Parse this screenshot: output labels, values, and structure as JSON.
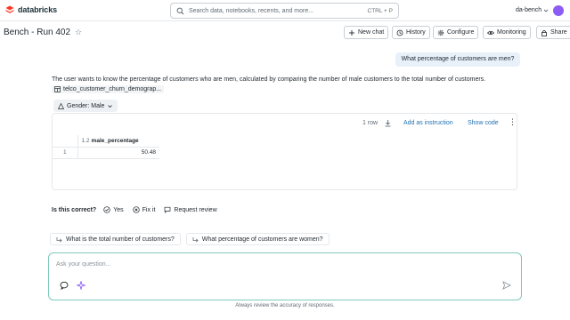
{
  "app": {
    "brand": "databricks",
    "search_placeholder": "Search data, notebooks, recents, and more...",
    "search_shortcut": "CTRL + P",
    "workspace": "da-bench"
  },
  "page": {
    "title": "Bench - Run 402"
  },
  "toolbar": {
    "new_chat": "New chat",
    "history": "History",
    "configure": "Configure",
    "monitoring": "Monitoring",
    "share": "Share"
  },
  "chat": {
    "user_message": "What percentage of customers are men?",
    "assistant_text": "The user wants to know the percentage of customers who are men, calculated by comparing the number of male customers to the total number of customers.",
    "table_ref": "telco_customer_churn_demograp...",
    "filter_chip": "Gender: Male",
    "result": {
      "row_count": "1 row",
      "add_instruction": "Add as instruction",
      "show_code": "Show code",
      "columns": [
        {
          "type": "1.2",
          "name": "male_percentage"
        }
      ],
      "rows": [
        {
          "index": "1",
          "values": [
            "50.48"
          ]
        }
      ]
    },
    "feedback": {
      "label": "Is this correct?",
      "yes": "Yes",
      "fix": "Fix it",
      "review": "Request review"
    },
    "suggestions": [
      "What is the total number of customers?",
      "What percentage of customers are women?"
    ],
    "composer_placeholder": "Ask your question...",
    "disclaimer": "Always review the accuracy of responses."
  },
  "colors": {
    "accent_link": "#2272b4",
    "composer_border": "#7ec8ba",
    "user_bubble": "#e8f0fa",
    "brand_red": "#ff3621"
  }
}
